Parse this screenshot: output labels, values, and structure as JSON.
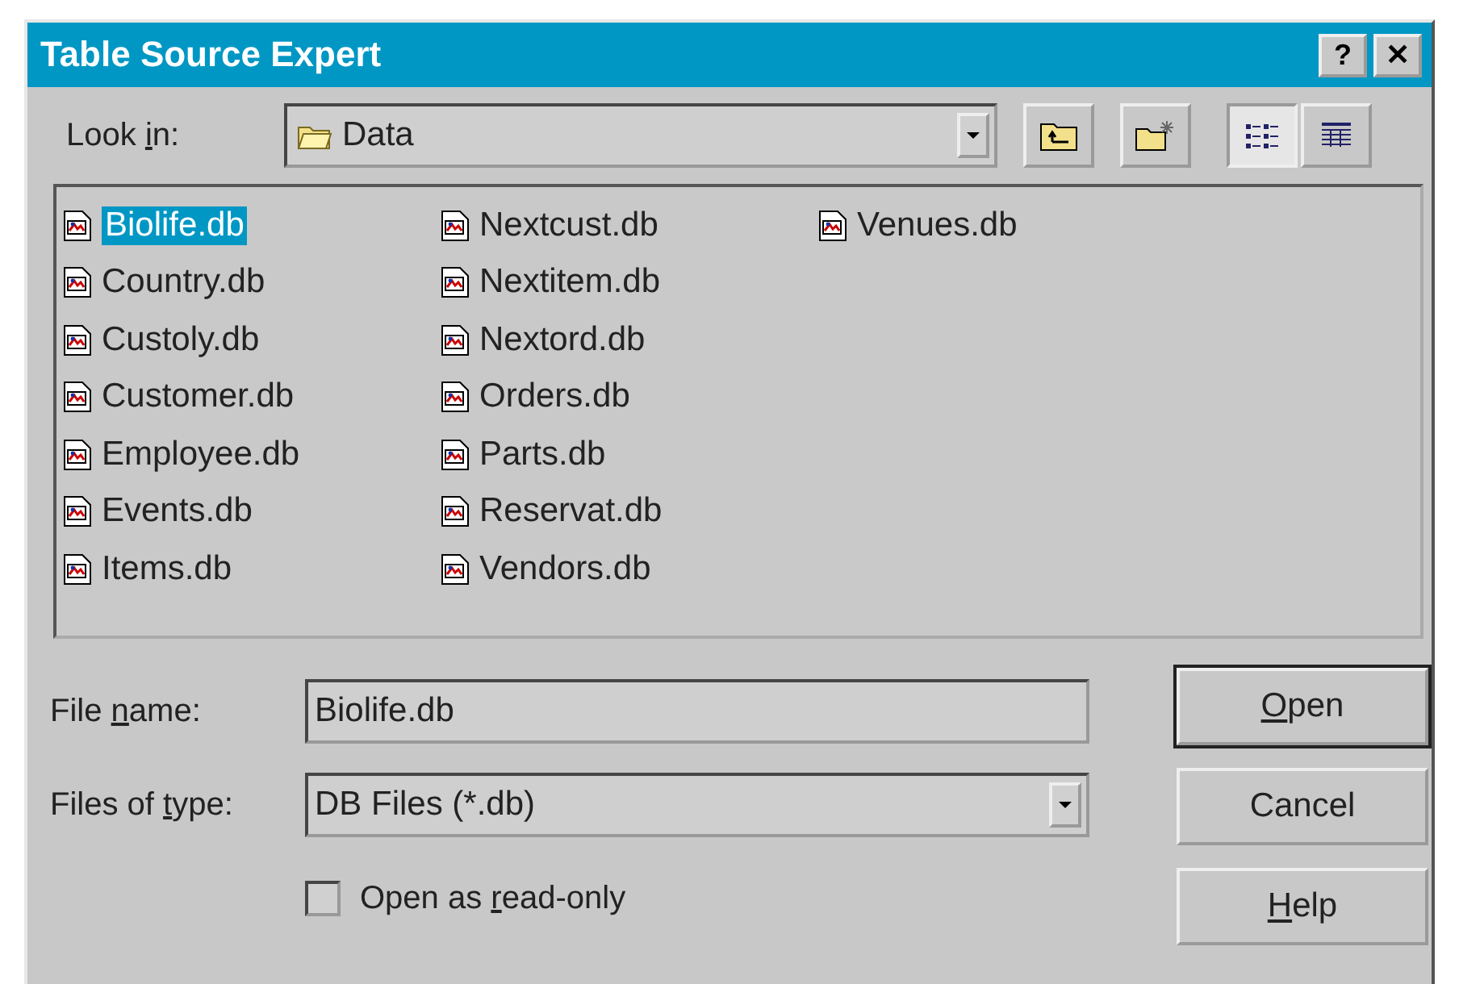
{
  "window": {
    "title": "Table Source Expert",
    "buttons": [
      {
        "kind": "help",
        "label": "?"
      },
      {
        "kind": "close",
        "label": "✕"
      }
    ]
  },
  "look_in": {
    "label": {
      "before": "Look ",
      "key": "i",
      "after": "n:"
    },
    "value": "Data"
  },
  "files": [
    {
      "name": "Biolife.db",
      "selected": true
    },
    {
      "name": "Country.db",
      "selected": false
    },
    {
      "name": "Custoly.db",
      "selected": false
    },
    {
      "name": "Customer.db",
      "selected": false
    },
    {
      "name": "Employee.db",
      "selected": false
    },
    {
      "name": "Events.db",
      "selected": false
    },
    {
      "name": "Items.db",
      "selected": false
    },
    {
      "name": "Nextcust.db",
      "selected": false
    },
    {
      "name": "Nextitem.db",
      "selected": false
    },
    {
      "name": "Nextord.db",
      "selected": false
    },
    {
      "name": "Orders.db",
      "selected": false
    },
    {
      "name": "Parts.db",
      "selected": false
    },
    {
      "name": "Reservat.db",
      "selected": false
    },
    {
      "name": "Vendors.db",
      "selected": false
    },
    {
      "name": "Venues.db",
      "selected": false
    }
  ],
  "file_name": {
    "label": {
      "before": "File ",
      "key": "n",
      "after": "ame:"
    },
    "value": "Biolife.db"
  },
  "files_of_type": {
    "label": {
      "before": "Files of ",
      "key": "t",
      "after": "ype:"
    },
    "value": "DB Files (*.db)"
  },
  "read_only": {
    "label": {
      "before": "Open as ",
      "key": "r",
      "after": "ead-only"
    },
    "checked": false
  },
  "buttons": [
    {
      "label": {
        "key": "O",
        "after": "pen"
      },
      "default": true
    },
    {
      "label": {
        "before": "Cancel"
      },
      "default": false
    },
    {
      "label": {
        "key": "H",
        "after": "elp"
      },
      "default": false
    }
  ]
}
